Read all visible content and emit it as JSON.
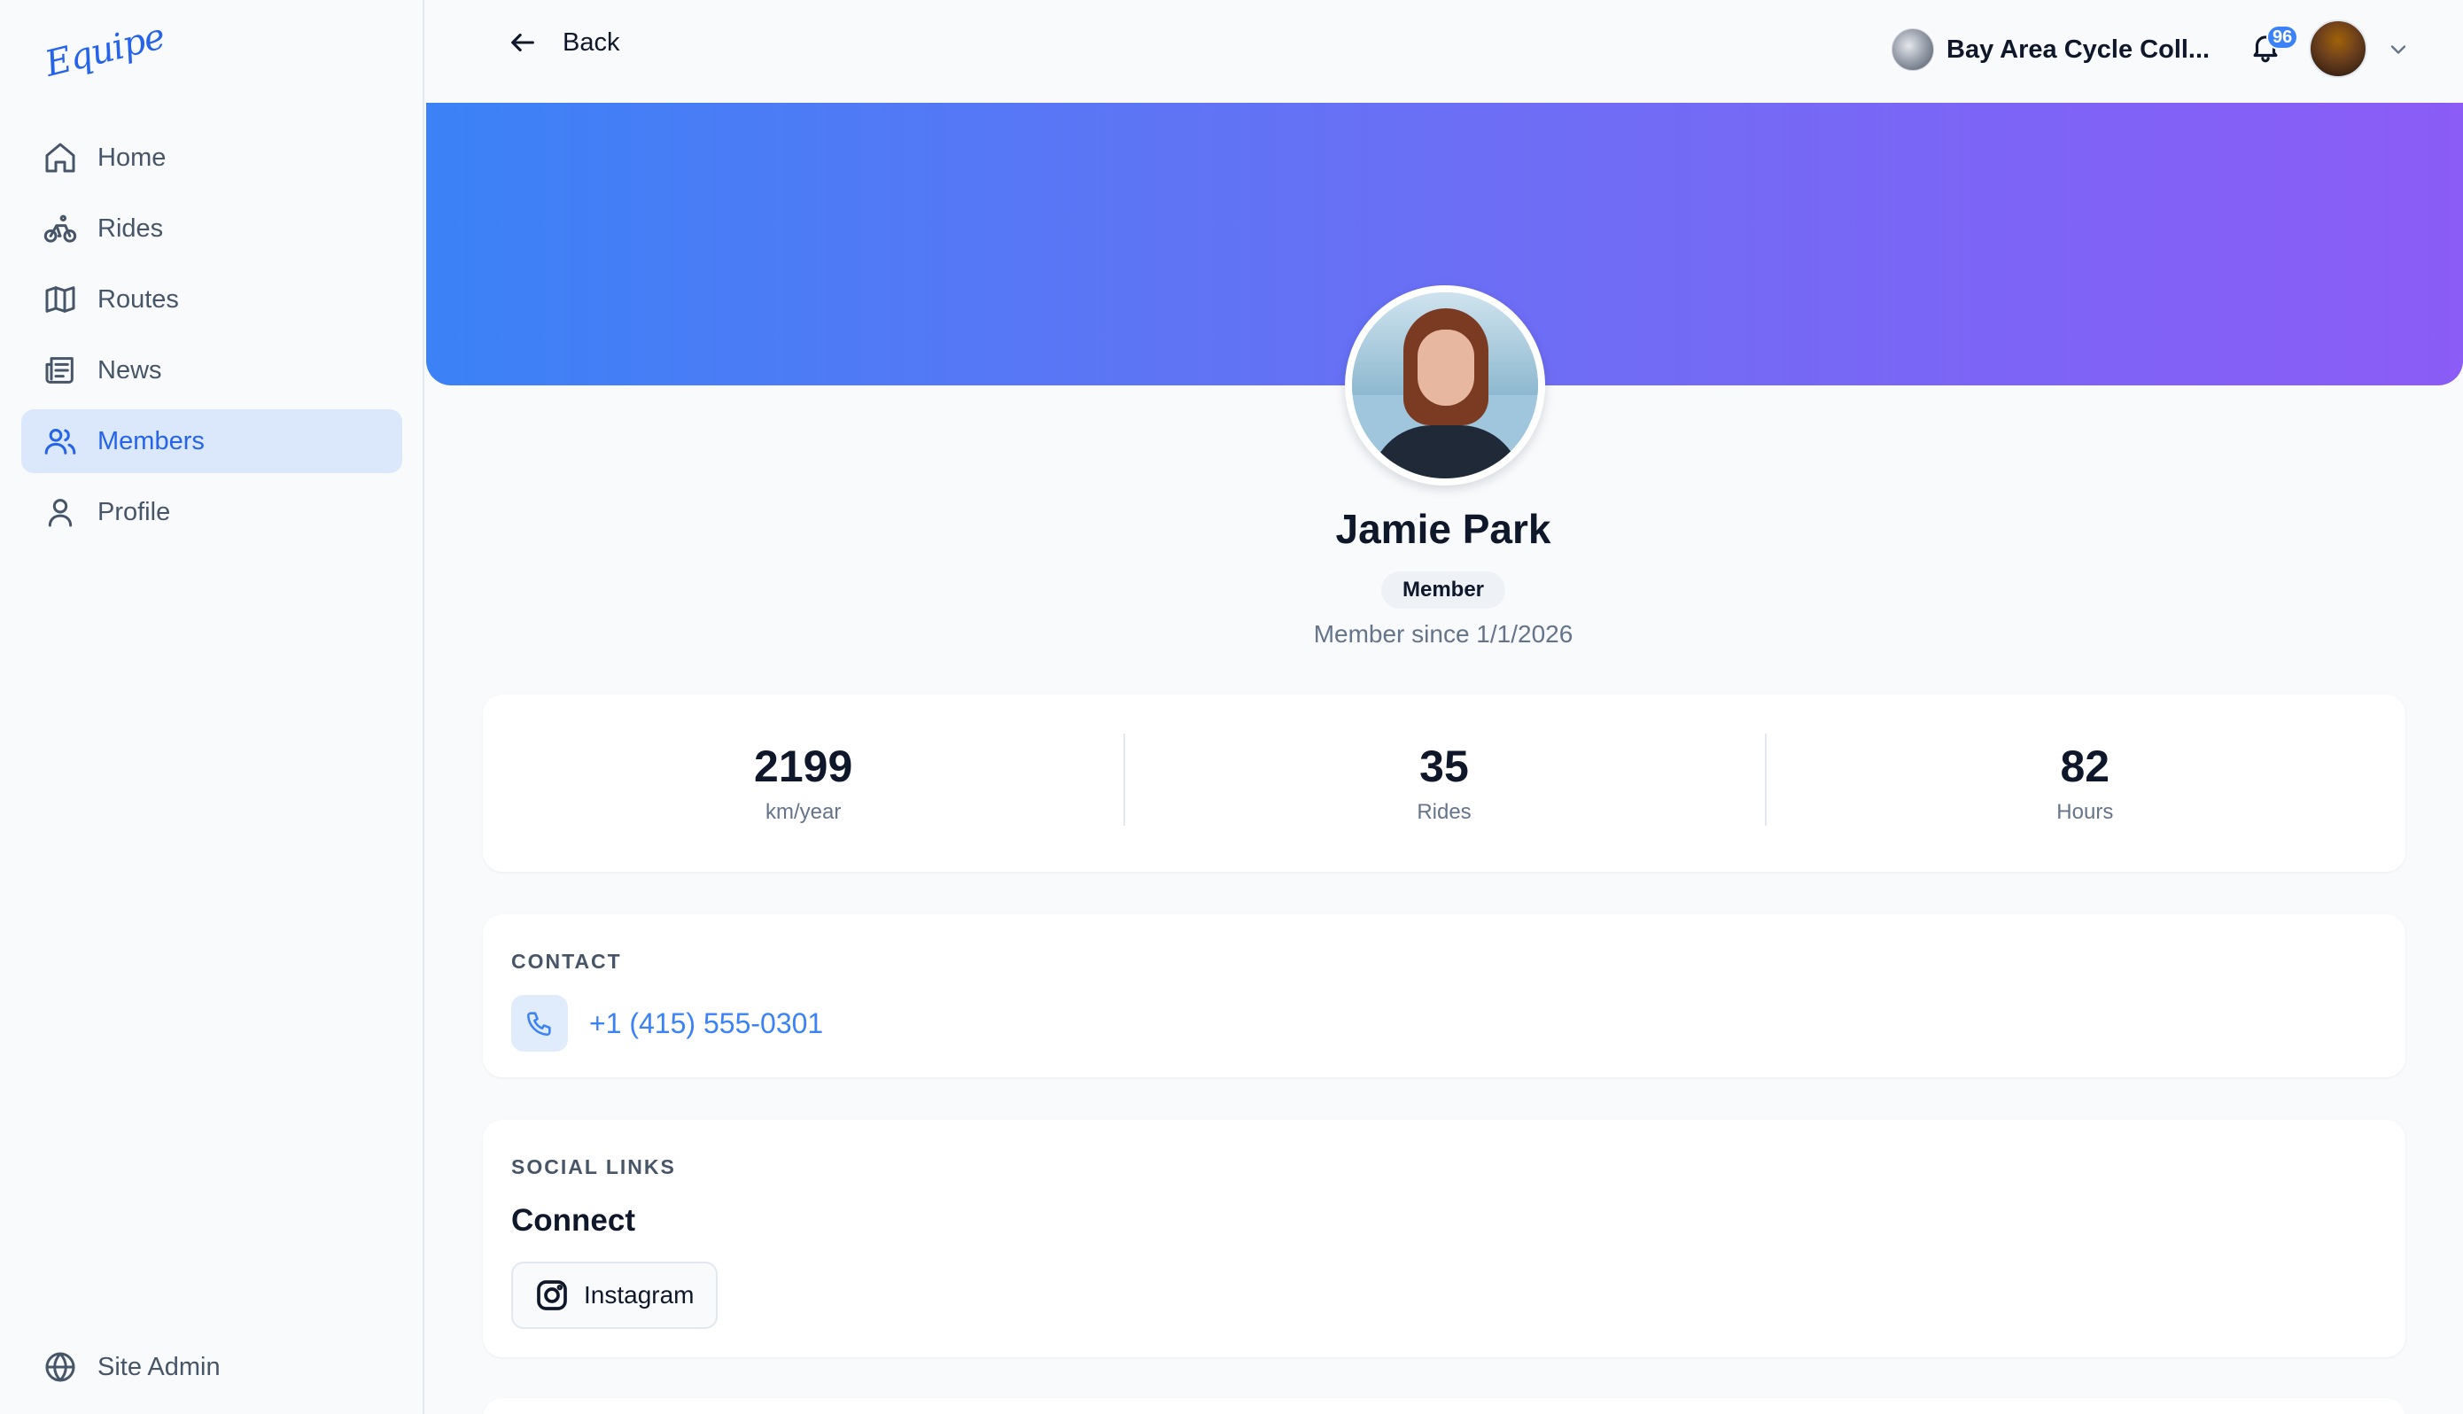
{
  "brand": {
    "logo_text": "Equipe"
  },
  "sidebar": {
    "items": [
      {
        "label": "Home",
        "icon": "home-icon"
      },
      {
        "label": "Rides",
        "icon": "bicycle-icon"
      },
      {
        "label": "Routes",
        "icon": "map-icon"
      },
      {
        "label": "News",
        "icon": "newspaper-icon"
      },
      {
        "label": "Members",
        "icon": "users-icon",
        "active": true
      },
      {
        "label": "Profile",
        "icon": "user-icon"
      }
    ],
    "footer": {
      "label": "Site Admin",
      "icon": "globe-icon"
    }
  },
  "header": {
    "back_label": "Back",
    "club_name": "Bay Area Cycle Coll...",
    "notification_count": "96"
  },
  "profile": {
    "name": "Jamie Park",
    "role": "Member",
    "member_since": "Member since 1/1/2026"
  },
  "stats": [
    {
      "value": "2199",
      "label": "km/year"
    },
    {
      "value": "35",
      "label": "Rides"
    },
    {
      "value": "82",
      "label": "Hours"
    }
  ],
  "contact": {
    "title": "CONTACT",
    "phone": "+1 (415) 555-0301"
  },
  "social": {
    "title": "SOCIAL LINKS",
    "heading": "Connect",
    "instagram_label": "Instagram"
  },
  "colors": {
    "accent": "#3b82f6",
    "banner_start": "#3b82f6",
    "banner_end": "#8b5cf6",
    "active_nav_bg": "#dbe8fc"
  }
}
